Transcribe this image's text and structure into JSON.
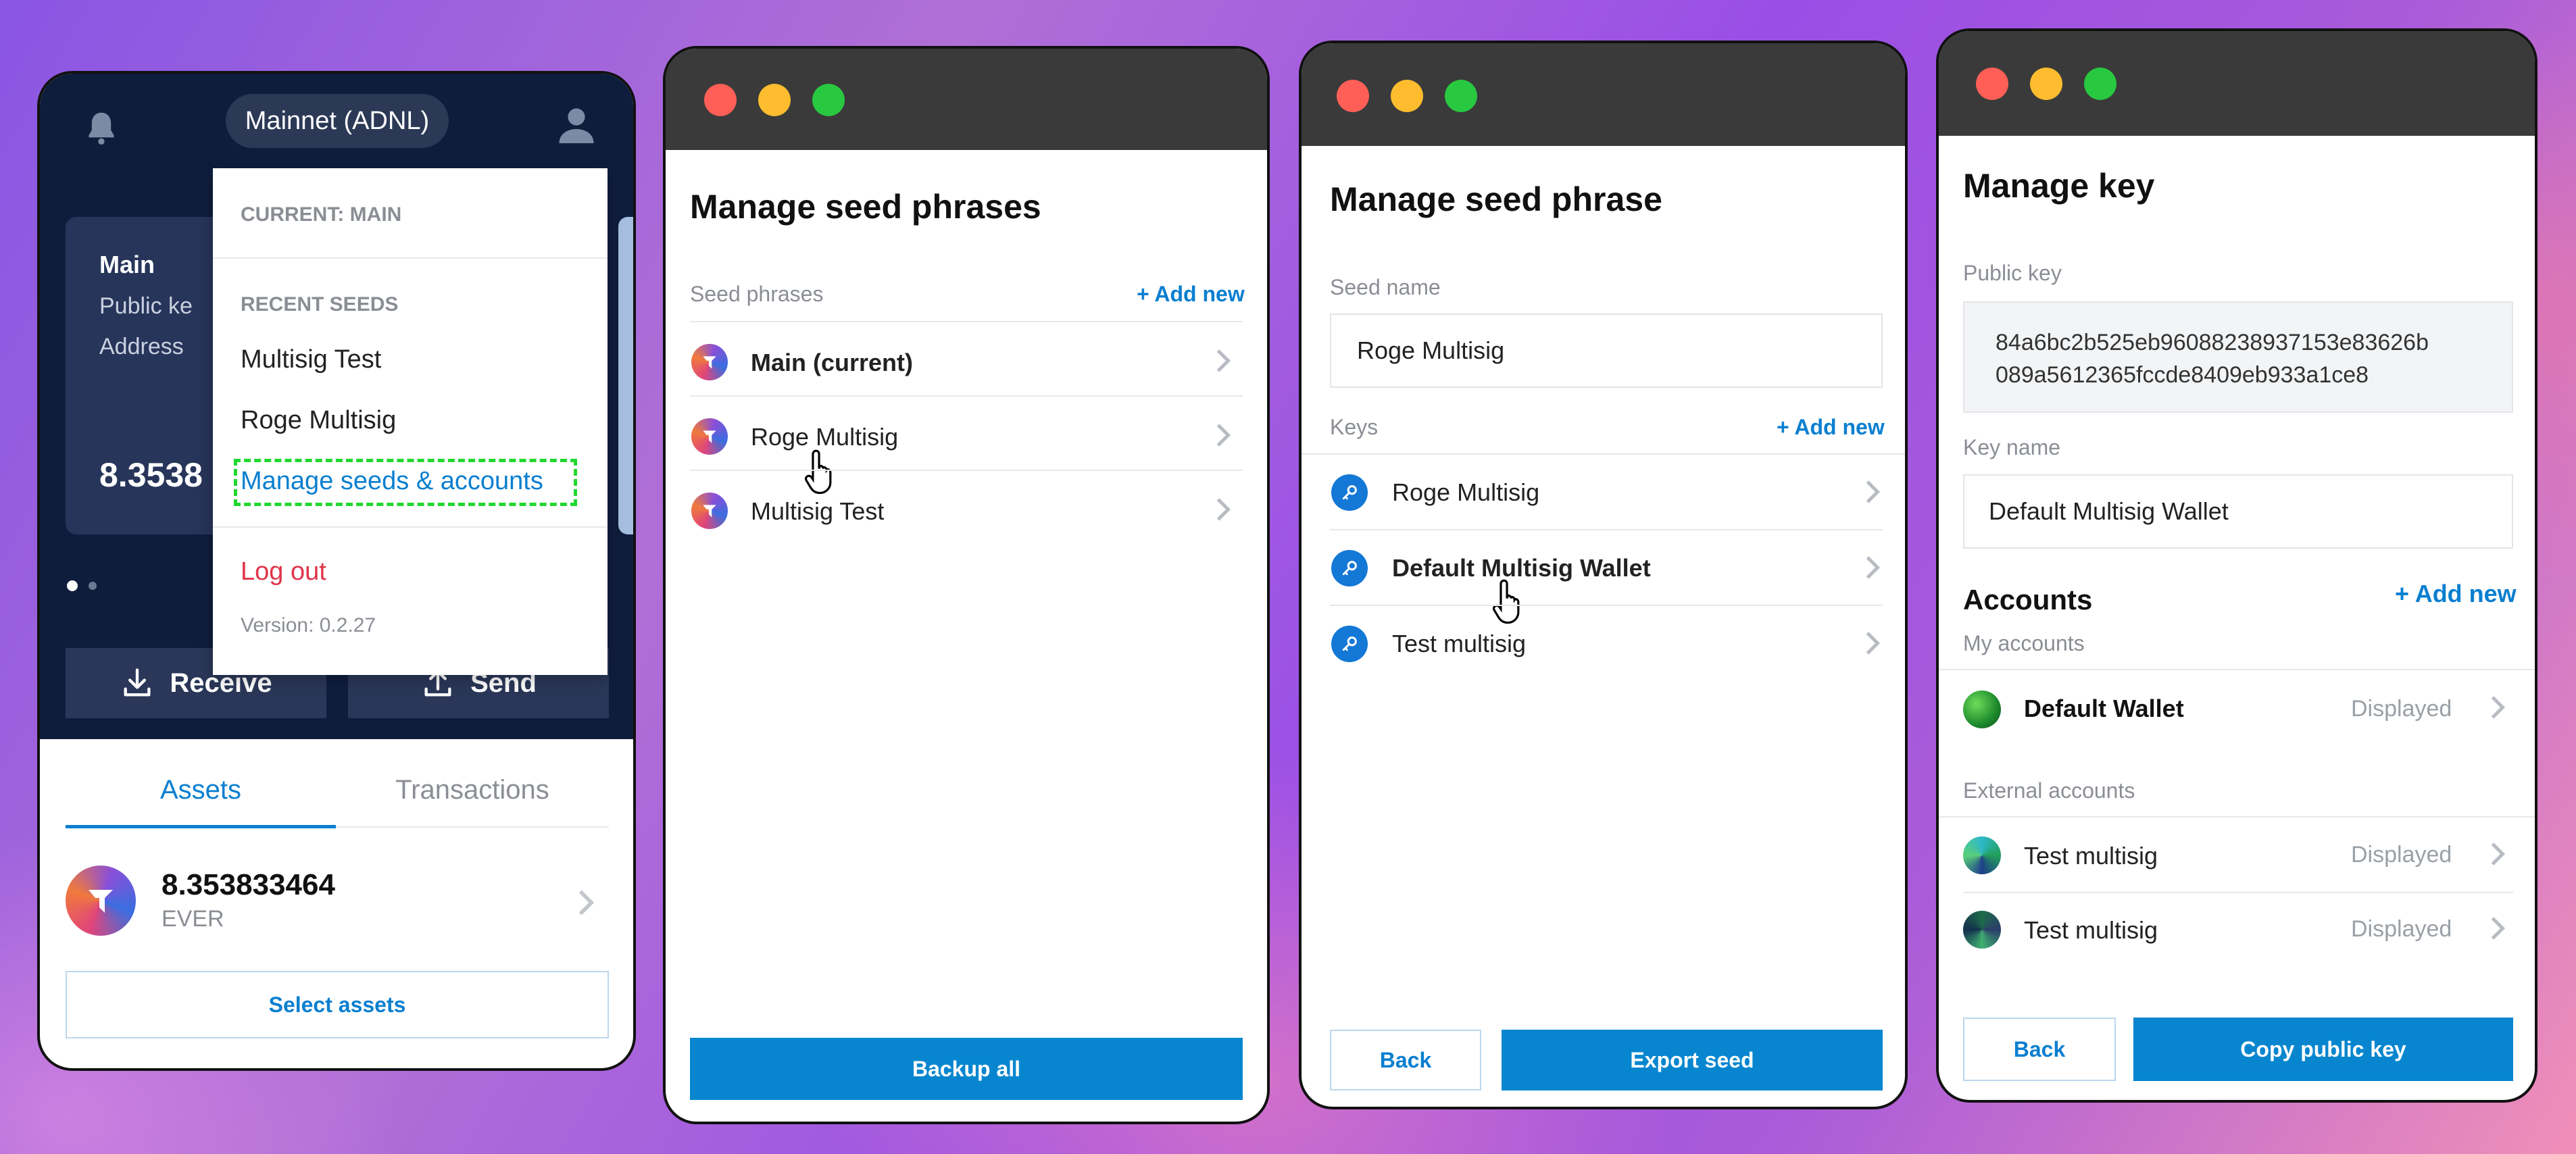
{
  "wallet": {
    "network": "Mainnet (ADNL)",
    "card_title": "Main",
    "card_line1": "Public ke",
    "card_line2": "Address",
    "card_balance": "8.3538",
    "receive_label": "Receive",
    "send_label": "Send",
    "tabs": [
      "Assets",
      "Transactions"
    ],
    "asset_amount": "8.353833464",
    "asset_symbol": "EVER",
    "select_assets_label": "Select assets",
    "dropdown": {
      "current_label": "CURRENT: MAIN",
      "recent_label": "RECENT SEEDS",
      "recent": [
        "Multisig Test",
        "Roge Multisig"
      ],
      "manage_label": "Manage seeds & accounts",
      "logout_label": "Log out",
      "version": "Version: 0.2.27"
    }
  },
  "seeds_panel": {
    "title": "Manage seed phrases",
    "section_label": "Seed phrases",
    "add_new": "+ Add new",
    "items": [
      "Main (current)",
      "Roge Multisig",
      "Multisig Test"
    ],
    "backup_label": "Backup all"
  },
  "seed_panel": {
    "title": "Manage seed phrase",
    "seed_name_label": "Seed name",
    "seed_name_value": "Roge Multisig",
    "keys_label": "Keys",
    "add_new": "+ Add new",
    "keys": [
      "Roge Multisig",
      "Default Multisig Wallet",
      "Test multisig"
    ],
    "back_label": "Back",
    "export_label": "Export seed"
  },
  "key_panel": {
    "title": "Manage key",
    "public_key_label": "Public key",
    "public_key_line1": "84a6bc2b525eb96088238937153e83626b",
    "public_key_line2": "089a5612365fccde8409eb933a1ce8",
    "key_name_label": "Key name",
    "key_name_value": "Default Multisig Wallet",
    "accounts_label": "Accounts",
    "add_new": "+ Add new",
    "my_accounts_label": "My accounts",
    "my_accounts": [
      {
        "name": "Default Wallet",
        "status": "Displayed"
      }
    ],
    "external_label": "External accounts",
    "external": [
      {
        "name": "Test multisig",
        "status": "Displayed"
      },
      {
        "name": "Test multisig",
        "status": "Displayed"
      }
    ],
    "back_label": "Back",
    "copy_label": "Copy public key"
  },
  "colors": {
    "accent": "#0786cf",
    "wallet_bg": "#0f1d3d",
    "highlight_dash": "#22d82f",
    "logout": "#e0334a"
  },
  "icons": [
    "bell-icon",
    "profile-icon",
    "download-icon",
    "upload-icon",
    "chevron-right-icon",
    "key-icon",
    "token-icon",
    "hand-cursor-icon"
  ]
}
